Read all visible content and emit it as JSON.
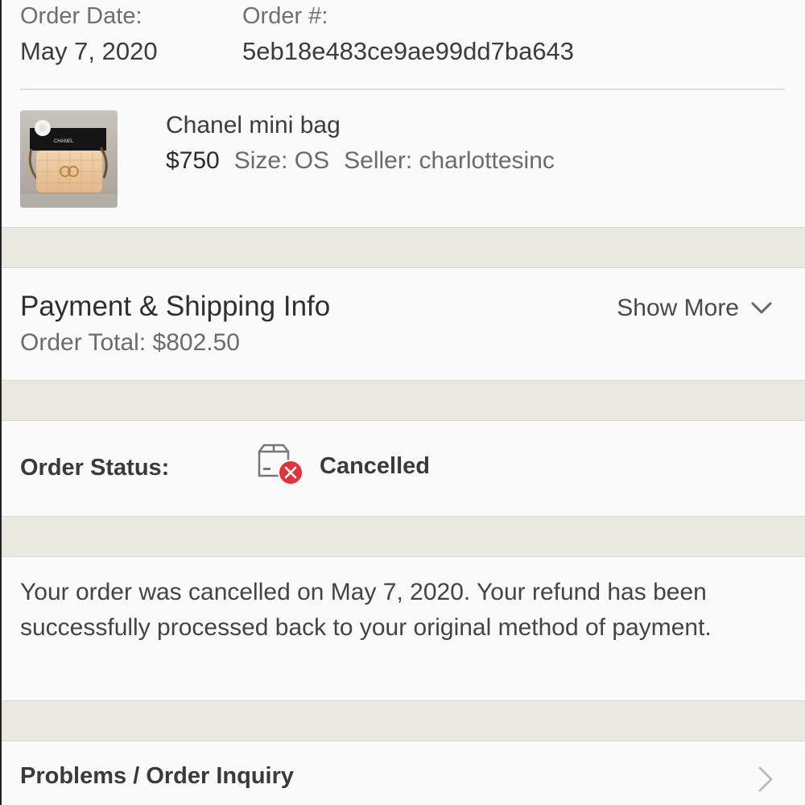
{
  "order": {
    "date_label": "Order Date:",
    "date_value": "May 7, 2020",
    "number_label": "Order #:",
    "number_value": "5eb18e483ce9ae99dd7ba643"
  },
  "item": {
    "name": "Chanel mini bag",
    "price": "$750",
    "size": "Size: OS",
    "seller": "Seller: charlottesinc",
    "thumbnail_box_text": "CHANEL"
  },
  "payment": {
    "title": "Payment & Shipping Info",
    "order_total": "Order Total: $802.50",
    "show_more_label": "Show More",
    "show_more_icon": "chevron-down-icon"
  },
  "status": {
    "label": "Order Status:",
    "value": "Cancelled",
    "icon": "box-cancelled-icon"
  },
  "message": {
    "text": "Your order was cancelled on May 7, 2020. Your refund has been successfully processed back to your original method of payment."
  },
  "problems": {
    "label": "Problems / Order Inquiry",
    "icon": "chevron-right-icon"
  },
  "colors": {
    "background": "#fbfafa",
    "separator": "#ebe8e1",
    "cancel_red": "#e0343b"
  }
}
